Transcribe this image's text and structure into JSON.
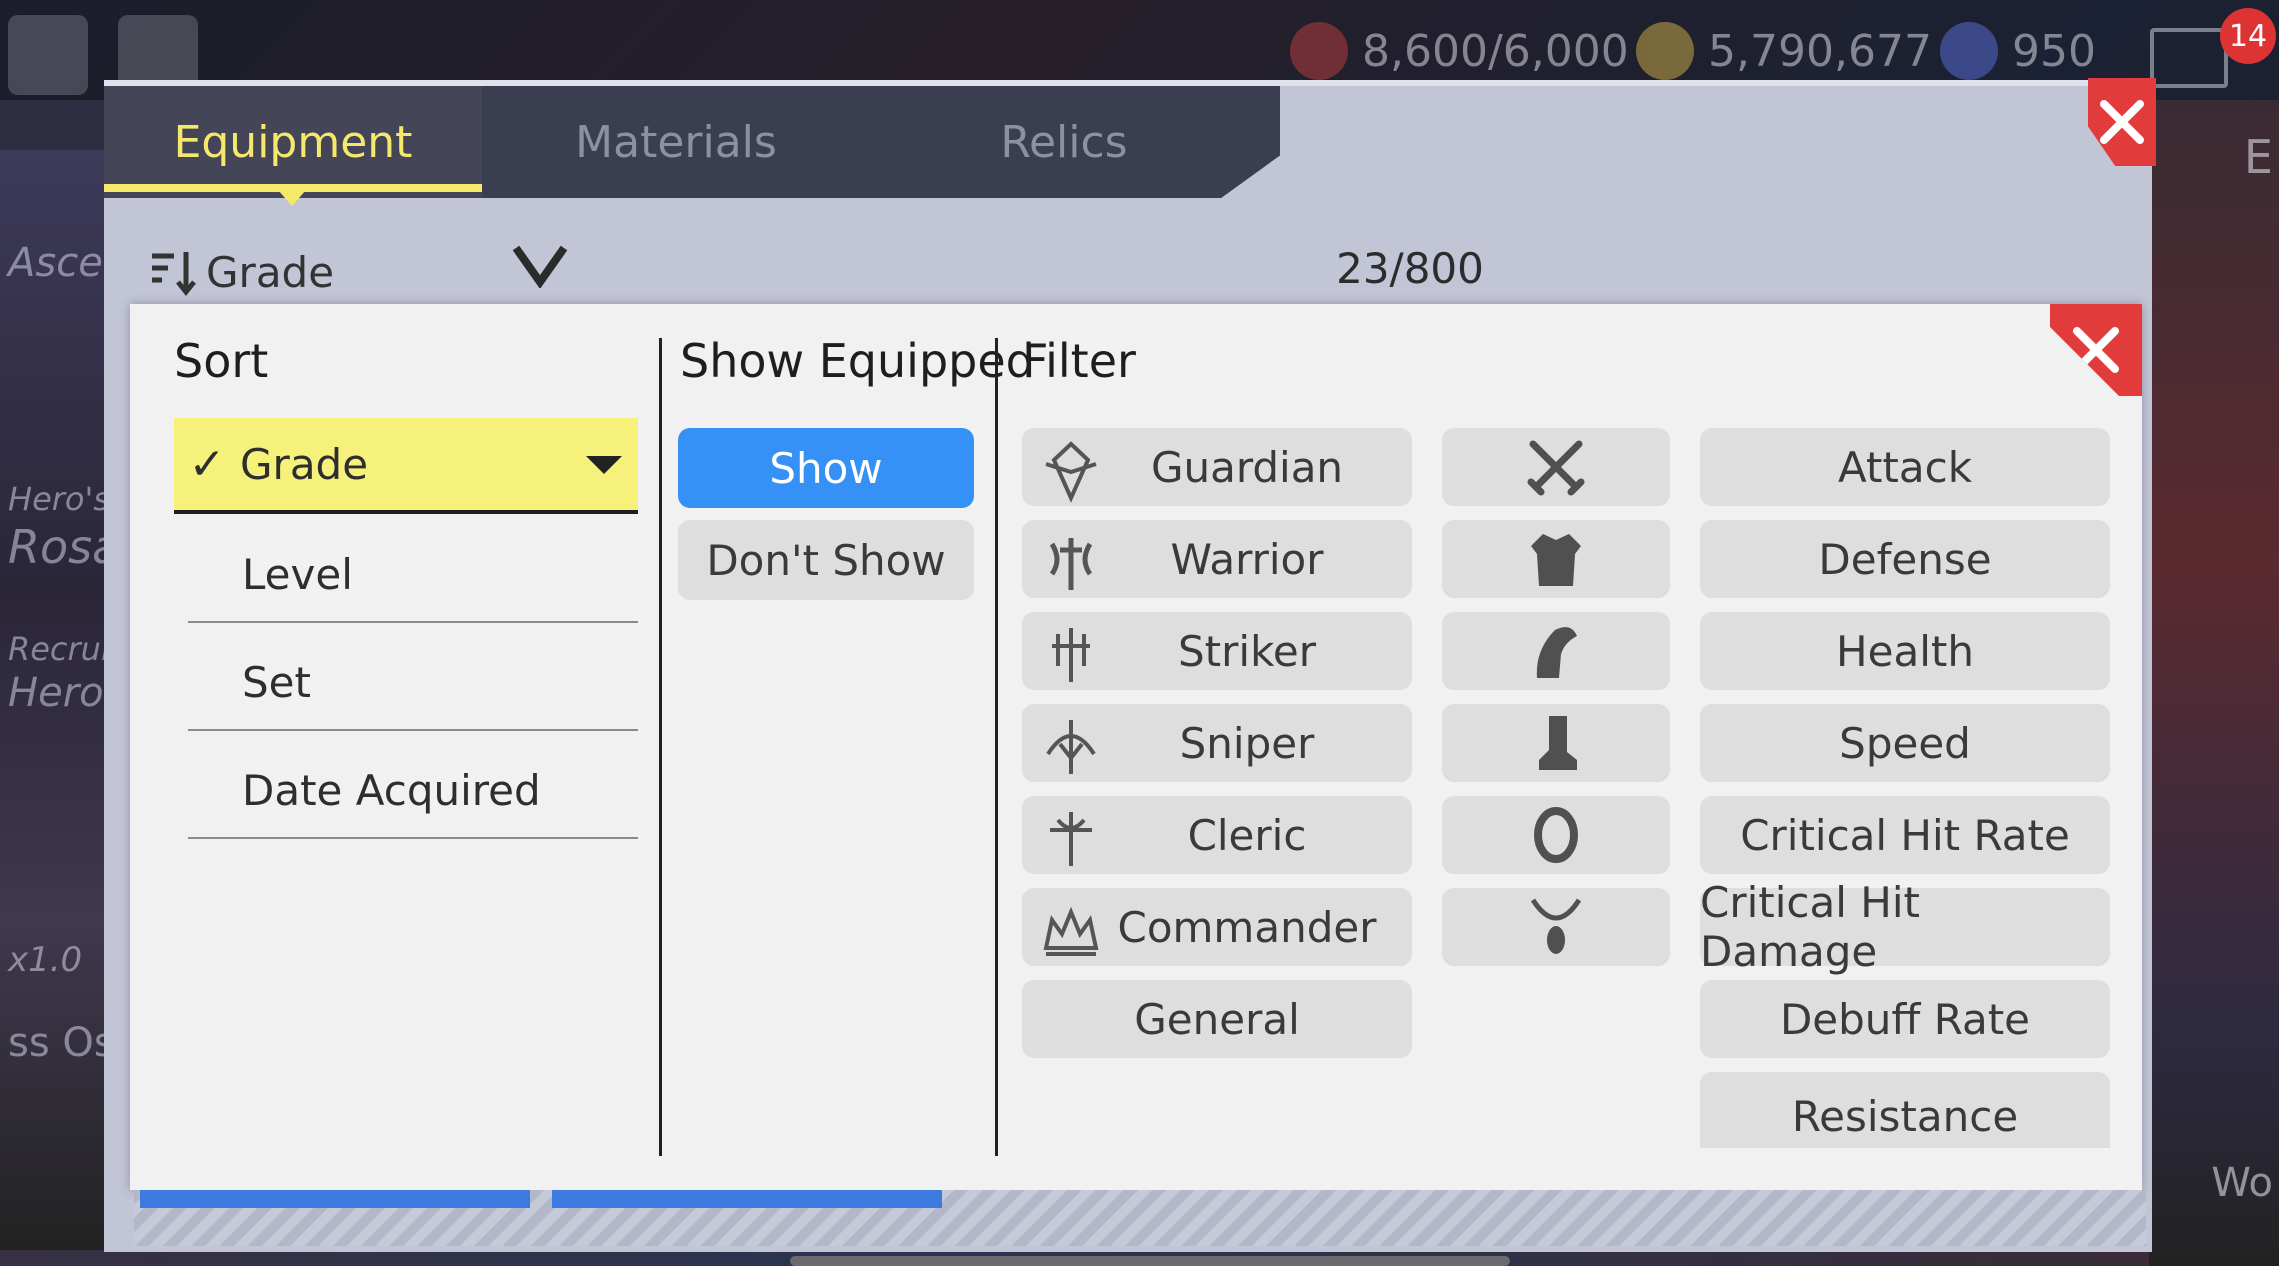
{
  "hud": {
    "stamina": "8,600/6,000",
    "gold": "5,790,677",
    "gems": "950",
    "mail_badge": "14"
  },
  "background_labels": {
    "ascend": "Ascen",
    "hero_s": "Hero's",
    "rosa": "Rosa",
    "recruit": "Recruit",
    "hero": "Hero (",
    "mult": "x1.0",
    "boss": "ss Oswa",
    "right_letter": "E",
    "right_bottom": "Wo"
  },
  "tabs": [
    {
      "label": "Equipment",
      "active": true
    },
    {
      "label": "Materials",
      "active": false
    },
    {
      "label": "Relics",
      "active": false
    }
  ],
  "sort_bar": {
    "label": "Grade",
    "count": "23/800"
  },
  "popup": {
    "sort_heading": "Sort",
    "show_heading": "Show Equipped",
    "filter_heading": "Filter",
    "sort_options": [
      "Grade",
      "Level",
      "Set",
      "Date Acquired"
    ],
    "selected_sort": "Grade",
    "show_options": [
      "Show",
      "Don't Show"
    ],
    "selected_show": "Show",
    "classes": [
      {
        "label": "Guardian",
        "icon": "guardian-class-icon"
      },
      {
        "label": "Warrior",
        "icon": "warrior-class-icon"
      },
      {
        "label": "Striker",
        "icon": "striker-class-icon"
      },
      {
        "label": "Sniper",
        "icon": "sniper-class-icon"
      },
      {
        "label": "Cleric",
        "icon": "cleric-class-icon"
      },
      {
        "label": "Commander",
        "icon": "commander-class-icon"
      },
      {
        "label": "General",
        "icon": ""
      }
    ],
    "slots": [
      "weapon-icon",
      "armor-icon",
      "gloves-icon",
      "boots-icon",
      "ring-icon",
      "necklace-icon"
    ],
    "stats": [
      "Attack",
      "Defense",
      "Health",
      "Speed",
      "Critical Hit Rate",
      "Critical Hit Damage",
      "Debuff Rate",
      "Resistance"
    ]
  },
  "colors": {
    "accent_yellow": "#f5e86a",
    "selected_blue": "#3591f5",
    "close_red": "#e23b3b"
  }
}
